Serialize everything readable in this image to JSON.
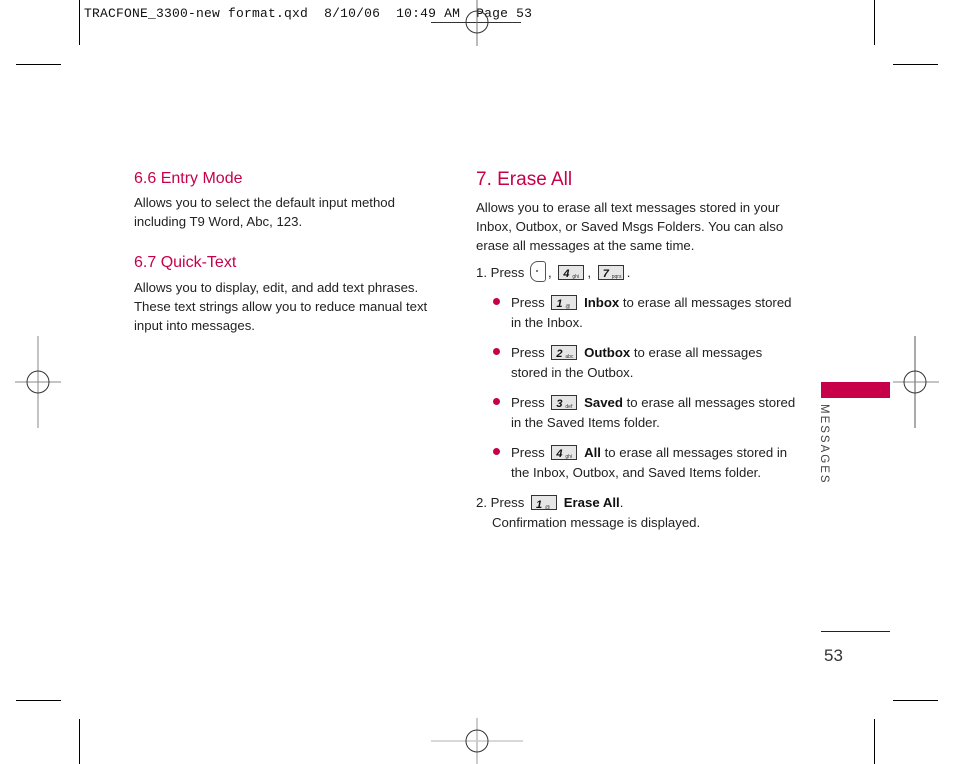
{
  "print_header": {
    "filename": "TRACFONE_3300-new format.qxd",
    "date": "8/10/06",
    "time": "10:49 AM",
    "page_label": "Page 53"
  },
  "left_column": {
    "sections": [
      {
        "heading": "6.6 Entry Mode",
        "lines": [
          "Allows you to select the default input method",
          "including T9 Word, Abc, 123."
        ]
      },
      {
        "heading": "6.7 Quick-Text",
        "lines": [
          "Allows you to display, edit, and add text phrases.",
          "These text strings allow you to reduce manual text",
          "input into messages."
        ]
      }
    ]
  },
  "right_column": {
    "heading": "7. Erase All",
    "intro_lines": [
      "Allows you to erase all text messages stored in your",
      "Inbox, Outbox, or Saved Msgs Folders. You can also",
      "erase all messages at the same time."
    ],
    "step1": {
      "prefix": "1. Press",
      "keys": [
        {
          "icon": "nav-key-icon"
        },
        {
          "num": "4",
          "sub": "ghi"
        },
        {
          "num": "7",
          "sub": "pqrs"
        }
      ],
      "sep": ",",
      "end": "."
    },
    "bullets": [
      {
        "press": "Press",
        "key_num": "1",
        "key_sub": "@",
        "bold": "Inbox",
        "line1": " to erase all messages stored",
        "line2": "in the Inbox."
      },
      {
        "press": "Press",
        "key_num": "2",
        "key_sub": "abc",
        "bold": "Outbox",
        "line1": " to erase all messages",
        "line2": "stored in the Outbox."
      },
      {
        "press": "Press",
        "key_num": "3",
        "key_sub": "def",
        "bold": "Saved",
        "line1": " to erase all messages stored",
        "line2": "in the Saved Items folder."
      },
      {
        "press": "Press",
        "key_num": "4",
        "key_sub": "ghi",
        "bold": "All",
        "line1": " to erase all messages stored in",
        "line2": "the Inbox, Outbox, and Saved Items folder."
      }
    ],
    "step2": {
      "prefix": "2. Press",
      "key_num": "1",
      "key_sub": "@",
      "bold": "Erase All",
      "end": ".",
      "line2": "Confirmation message is displayed."
    }
  },
  "side_tab": {
    "label": "MESSAGES",
    "color": "#c8004a"
  },
  "page_number": "53",
  "accent_color": "#c8004a"
}
